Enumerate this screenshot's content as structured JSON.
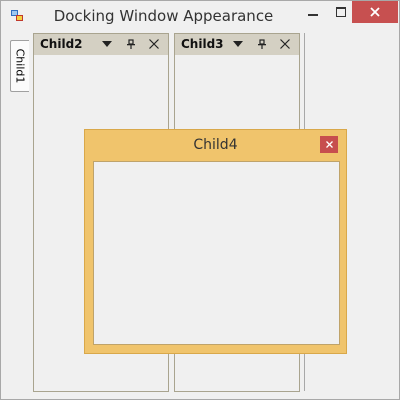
{
  "window": {
    "title": "Docking Window Appearance"
  },
  "side_tab": {
    "label": "Child1"
  },
  "panes": [
    {
      "title": "Child2"
    },
    {
      "title": "Child3"
    }
  ],
  "float_window": {
    "title": "Child4"
  },
  "colors": {
    "float_background": "#f0c46c",
    "pane_header": "#d4d0c3",
    "close_red": "#c74e4e"
  },
  "icons": {
    "app": "app-icon",
    "minimize": "minimize-icon",
    "maximize": "maximize-icon",
    "close": "close-icon",
    "dropdown": "chevron-down-icon",
    "pin": "pin-icon"
  }
}
